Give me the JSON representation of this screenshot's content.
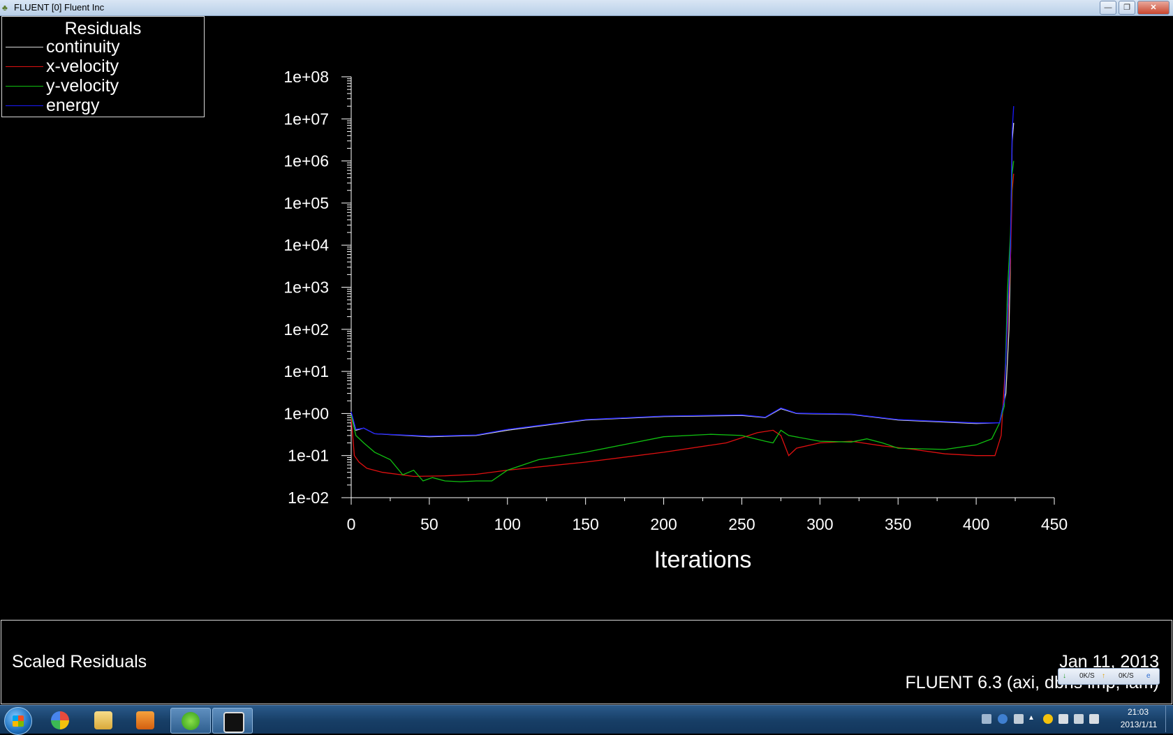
{
  "window": {
    "title": "FLUENT [0] Fluent Inc",
    "minimize_label": "—",
    "restore_label": "❐",
    "close_label": "✕"
  },
  "legend": {
    "title": "Residuals",
    "items": [
      {
        "label": "continuity",
        "color": "#d9d9d9"
      },
      {
        "label": "x-velocity",
        "color": "#e01010"
      },
      {
        "label": "y-velocity",
        "color": "#10c010"
      },
      {
        "label": "energy",
        "color": "#1a1aff"
      }
    ]
  },
  "chart_data": {
    "type": "line",
    "xlabel": "Iterations",
    "ylabel": "",
    "xlim": [
      0,
      450
    ],
    "ylim": [
      0.01,
      100000000.0
    ],
    "yscale": "log",
    "x_ticks": [
      "0",
      "50",
      "100",
      "150",
      "200",
      "250",
      "300",
      "350",
      "400",
      "450"
    ],
    "y_ticks": [
      "1e-02",
      "1e-01",
      "1e+00",
      "1e+01",
      "1e+02",
      "1e+03",
      "1e+04",
      "1e+05",
      "1e+06",
      "1e+07",
      "1e+08"
    ],
    "legend_position": "top-left",
    "series": [
      {
        "name": "continuity",
        "color": "#d9d9d9",
        "points": [
          [
            0,
            1.0
          ],
          [
            3,
            0.4
          ],
          [
            8,
            0.45
          ],
          [
            15,
            0.33
          ],
          [
            50,
            0.28
          ],
          [
            80,
            0.3
          ],
          [
            100,
            0.4
          ],
          [
            150,
            0.7
          ],
          [
            200,
            0.85
          ],
          [
            250,
            0.9
          ],
          [
            265,
            0.8
          ],
          [
            275,
            1.3
          ],
          [
            285,
            1.0
          ],
          [
            320,
            0.95
          ],
          [
            350,
            0.7
          ],
          [
            400,
            0.58
          ],
          [
            415,
            0.6
          ],
          [
            419,
            3
          ],
          [
            421,
            100
          ],
          [
            422,
            5000
          ],
          [
            423,
            3000000
          ],
          [
            424,
            8000000
          ]
        ]
      },
      {
        "name": "x-velocity",
        "color": "#e01010",
        "points": [
          [
            0,
            0.8
          ],
          [
            2,
            0.1
          ],
          [
            5,
            0.07
          ],
          [
            10,
            0.05
          ],
          [
            20,
            0.04
          ],
          [
            40,
            0.032
          ],
          [
            60,
            0.033
          ],
          [
            80,
            0.036
          ],
          [
            100,
            0.045
          ],
          [
            150,
            0.07
          ],
          [
            200,
            0.12
          ],
          [
            240,
            0.2
          ],
          [
            260,
            0.35
          ],
          [
            270,
            0.4
          ],
          [
            275,
            0.3
          ],
          [
            280,
            0.1
          ],
          [
            285,
            0.15
          ],
          [
            300,
            0.2
          ],
          [
            320,
            0.22
          ],
          [
            340,
            0.17
          ],
          [
            360,
            0.14
          ],
          [
            380,
            0.11
          ],
          [
            400,
            0.1
          ],
          [
            412,
            0.1
          ],
          [
            416,
            0.3
          ],
          [
            418,
            5
          ],
          [
            420,
            100
          ],
          [
            422,
            5000
          ],
          [
            423,
            200000
          ],
          [
            424,
            500000
          ]
        ]
      },
      {
        "name": "y-velocity",
        "color": "#10c010",
        "points": [
          [
            0,
            0.9
          ],
          [
            3,
            0.3
          ],
          [
            8,
            0.2
          ],
          [
            15,
            0.12
          ],
          [
            25,
            0.08
          ],
          [
            33,
            0.035
          ],
          [
            40,
            0.045
          ],
          [
            46,
            0.025
          ],
          [
            52,
            0.03
          ],
          [
            60,
            0.025
          ],
          [
            70,
            0.024
          ],
          [
            80,
            0.025
          ],
          [
            90,
            0.025
          ],
          [
            100,
            0.045
          ],
          [
            120,
            0.08
          ],
          [
            150,
            0.12
          ],
          [
            200,
            0.28
          ],
          [
            230,
            0.32
          ],
          [
            250,
            0.3
          ],
          [
            265,
            0.22
          ],
          [
            270,
            0.2
          ],
          [
            275,
            0.4
          ],
          [
            280,
            0.3
          ],
          [
            300,
            0.22
          ],
          [
            320,
            0.21
          ],
          [
            330,
            0.25
          ],
          [
            340,
            0.2
          ],
          [
            350,
            0.15
          ],
          [
            380,
            0.14
          ],
          [
            400,
            0.18
          ],
          [
            410,
            0.25
          ],
          [
            415,
            0.6
          ],
          [
            418,
            1.5
          ],
          [
            420,
            800
          ],
          [
            422,
            20000
          ],
          [
            423,
            500000
          ],
          [
            424,
            1000000
          ]
        ]
      },
      {
        "name": "energy",
        "color": "#1a1aff",
        "points": [
          [
            0,
            1.1
          ],
          [
            3,
            0.42
          ],
          [
            8,
            0.45
          ],
          [
            15,
            0.33
          ],
          [
            50,
            0.29
          ],
          [
            80,
            0.31
          ],
          [
            100,
            0.42
          ],
          [
            150,
            0.72
          ],
          [
            200,
            0.87
          ],
          [
            250,
            0.93
          ],
          [
            265,
            0.82
          ],
          [
            275,
            1.35
          ],
          [
            285,
            1.02
          ],
          [
            320,
            0.97
          ],
          [
            350,
            0.72
          ],
          [
            400,
            0.6
          ],
          [
            415,
            0.6
          ],
          [
            418,
            2
          ],
          [
            420,
            200
          ],
          [
            422,
            10000
          ],
          [
            423,
            5000000
          ],
          [
            424,
            20000000
          ]
        ]
      }
    ]
  },
  "footer": {
    "left_label": "Scaled Residuals",
    "date": "Jan 11, 2013",
    "version": "FLUENT 6.3 (axi, dbns imp, lam)"
  },
  "net_monitor": {
    "down": "0K/S",
    "up": "0K/S"
  },
  "taskbar": {
    "time": "21:03",
    "date": "2013/1/11"
  }
}
